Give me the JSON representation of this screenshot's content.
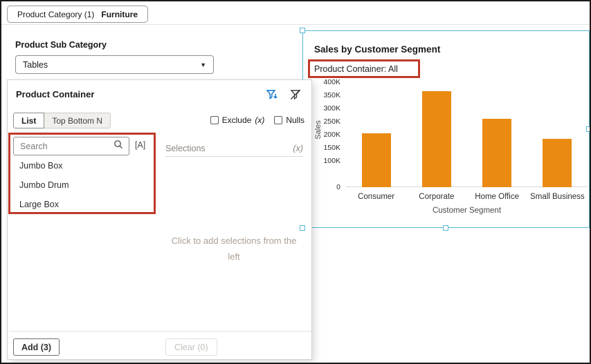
{
  "colors": {
    "annotation-red": "#C0392B",
    "selection-teal": "#58B6D2",
    "bar-orange": "#EA8A12",
    "icon-blue": "#0572CE"
  },
  "top_bar": {
    "chip_label": "Product Category (1)",
    "chip_value": "Furniture"
  },
  "sub_category": {
    "label": "Product Sub Category",
    "value": "Tables"
  },
  "filter_panel": {
    "title": "Product Container",
    "tabs": [
      {
        "label": "List"
      },
      {
        "label": "Top Bottom N"
      }
    ],
    "checkboxes": [
      {
        "label": "Exclude",
        "suffix": "(x)"
      },
      {
        "label": "Nulls",
        "suffix": ""
      }
    ],
    "search": {
      "placeholder": "Search",
      "match_case_label": "[A]"
    },
    "items": [
      "Jumbo Box",
      "Jumbo Drum",
      "Large Box"
    ],
    "selections": {
      "header": "Selections",
      "count_label": "(x)",
      "empty_text": "Click to add selections from the left"
    },
    "add_button": "Add (3)",
    "clear_button": "Clear (0)"
  },
  "chart_data": {
    "type": "bar",
    "title": "Sales by Customer Segment",
    "subtitle": "Product Container: All",
    "categories": [
      "Consumer",
      "Corporate",
      "Home Office",
      "Small Business"
    ],
    "values": [
      205000,
      365000,
      260000,
      185000
    ],
    "xlabel": "Customer Segment",
    "ylabel": "Sales",
    "ylim": [
      0,
      400000
    ],
    "yticks": [
      {
        "label": "400K",
        "value": 400000
      },
      {
        "label": "350K",
        "value": 350000
      },
      {
        "label": "300K",
        "value": 300000
      },
      {
        "label": "250K",
        "value": 250000
      },
      {
        "label": "200K",
        "value": 200000
      },
      {
        "label": "150K",
        "value": 150000
      },
      {
        "label": "100K",
        "value": 100000
      },
      {
        "label": "0",
        "value": 0
      }
    ],
    "bar_color": "#EA8A12",
    "grid": false,
    "legend": false
  }
}
